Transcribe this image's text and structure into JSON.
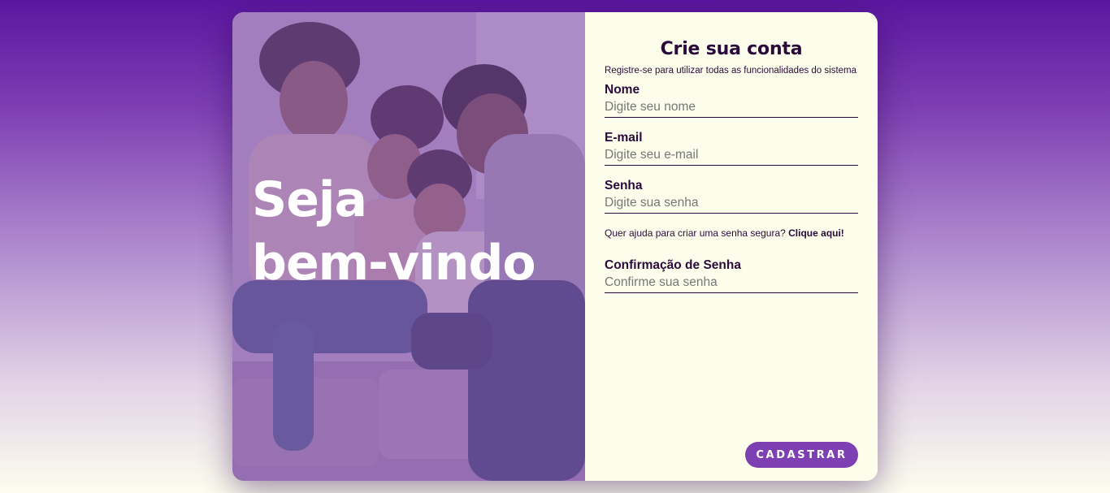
{
  "hero": {
    "title_line1": "Seja",
    "title_line2": "bem-vindo",
    "image_alt": "family-on-sofa-photo"
  },
  "form": {
    "title": "Crie sua conta",
    "subtitle": "Registre-se para utilizar todas as funcionalidades do sistema",
    "fields": [
      {
        "label": "Nome",
        "placeholder": "Digite seu nome",
        "value": ""
      },
      {
        "label": "E-mail",
        "placeholder": "Digite seu e-mail",
        "value": ""
      },
      {
        "label": "Senha",
        "placeholder": "Digite sua senha",
        "value": ""
      }
    ],
    "help": {
      "text": "Quer ajuda para criar uma senha segura? ",
      "link": "Clique aqui!"
    },
    "confirm": {
      "label": "Confirmação de Senha",
      "placeholder": "Confirme sua senha",
      "value": ""
    },
    "submit_label": "CADASTRAR"
  },
  "colors": {
    "accent": "#7d3fb1",
    "panel_bg": "#fdfdec",
    "text_dark": "#2a0a3a",
    "hero_overlay": "#8a5cab"
  }
}
